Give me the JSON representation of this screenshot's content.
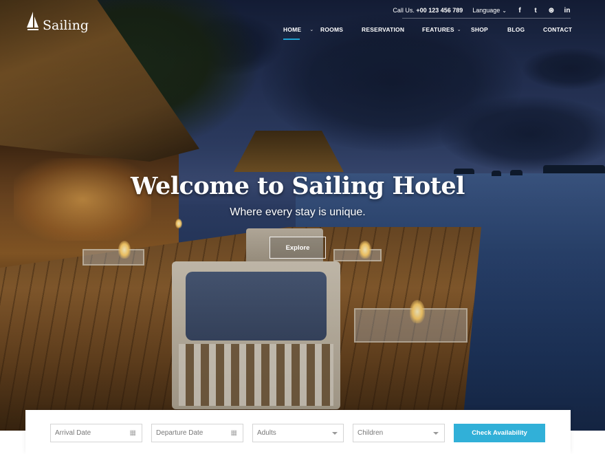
{
  "brand": {
    "name": "Sailing"
  },
  "topbar": {
    "call_label": "Call Us.",
    "phone": "+00 123 456 789",
    "language_label": "Language",
    "social": [
      {
        "icon": "facebook-icon",
        "glyph": "f"
      },
      {
        "icon": "twitter-icon",
        "glyph": "t"
      },
      {
        "icon": "tripadvisor-icon",
        "glyph": "⊛"
      },
      {
        "icon": "linkedin-icon",
        "glyph": "in"
      }
    ]
  },
  "nav": {
    "items": [
      {
        "label": "HOME",
        "has_dropdown": true,
        "active": true
      },
      {
        "label": "ROOMS",
        "has_dropdown": false
      },
      {
        "label": "RESERVATION",
        "has_dropdown": false
      },
      {
        "label": "FEATURES",
        "has_dropdown": true
      },
      {
        "label": "SHOP",
        "has_dropdown": false
      },
      {
        "label": "BLOG",
        "has_dropdown": false
      },
      {
        "label": "CONTACT",
        "has_dropdown": false
      }
    ],
    "accent": "#1fa2d3"
  },
  "hero": {
    "title": "Welcome to Sailing Hotel",
    "subtitle": "Where every stay is unique.",
    "cta_label": "Explore"
  },
  "booking": {
    "arrival_placeholder": "Arrival Date",
    "departure_placeholder": "Departure Date",
    "adults_label": "Adults",
    "children_label": "Children",
    "submit_label": "Check Availability",
    "submit_color": "#31b0d8"
  }
}
